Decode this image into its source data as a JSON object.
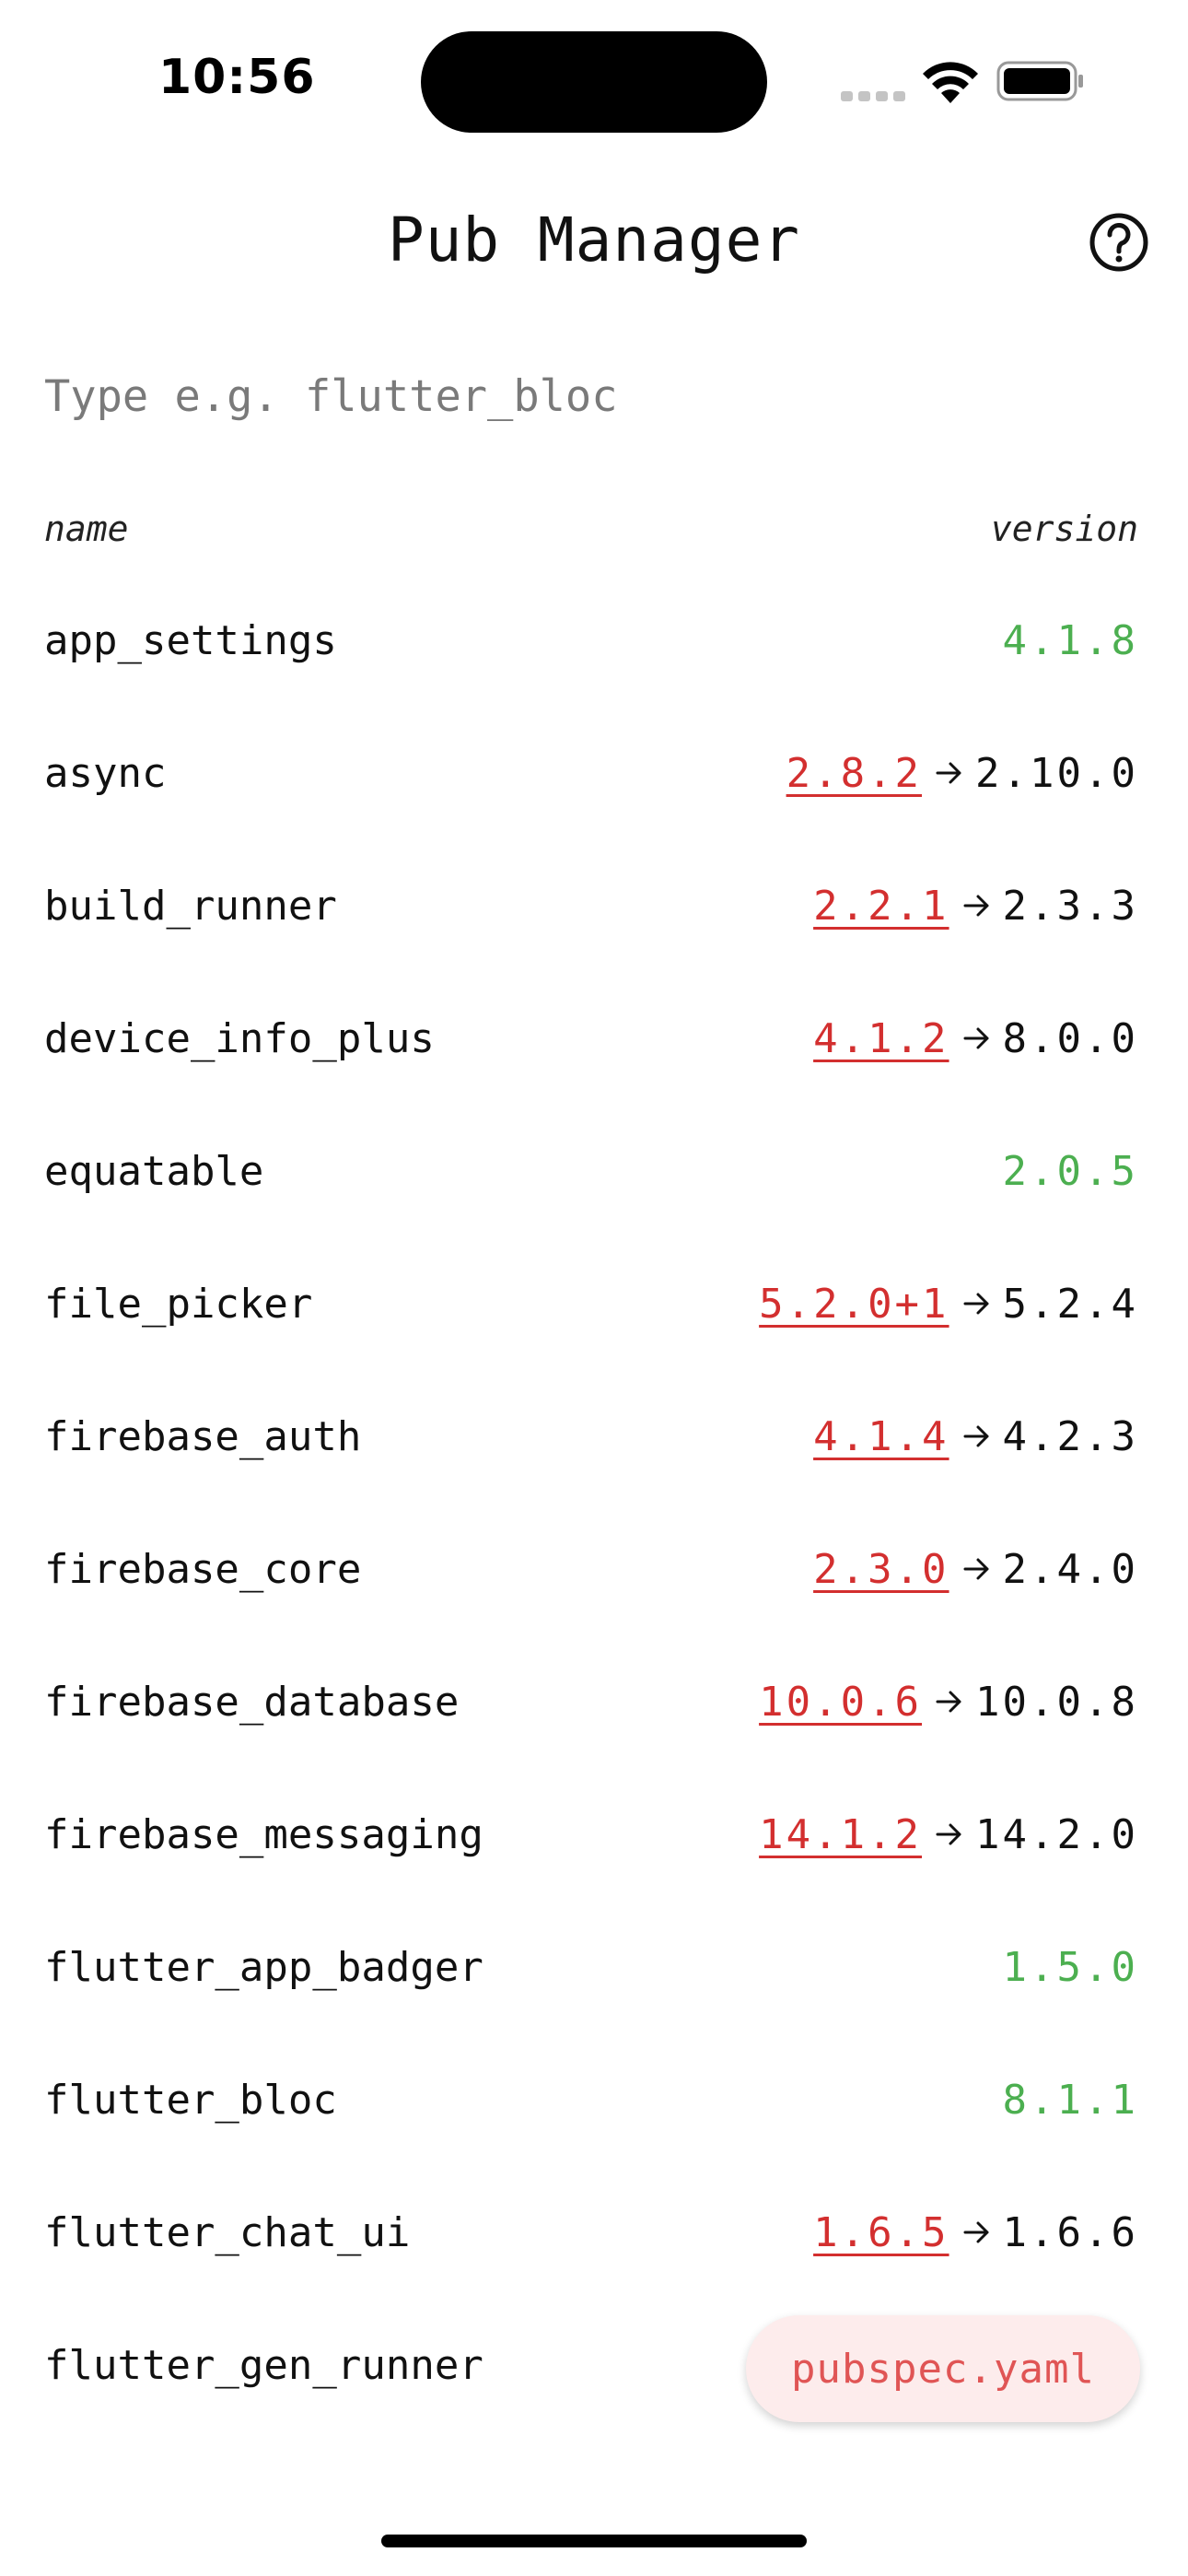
{
  "status_bar": {
    "time": "10:56"
  },
  "header": {
    "title": "Pub Manager",
    "help_icon": "question-circle-icon"
  },
  "search": {
    "placeholder": "Type e.g. flutter_bloc",
    "value": ""
  },
  "table": {
    "col_name": "name",
    "col_version": "version"
  },
  "packages": [
    {
      "name": "app_settings",
      "current": "4.1.8",
      "latest": "",
      "up_to_date": true
    },
    {
      "name": "async",
      "current": "2.8.2",
      "latest": "2.10.0",
      "up_to_date": false
    },
    {
      "name": "build_runner",
      "current": "2.2.1",
      "latest": "2.3.3",
      "up_to_date": false
    },
    {
      "name": "device_info_plus",
      "current": "4.1.2",
      "latest": "8.0.0",
      "up_to_date": false
    },
    {
      "name": "equatable",
      "current": "2.0.5",
      "latest": "",
      "up_to_date": true
    },
    {
      "name": "file_picker",
      "current": "5.2.0+1",
      "latest": "5.2.4",
      "up_to_date": false
    },
    {
      "name": "firebase_auth",
      "current": "4.1.4",
      "latest": "4.2.3",
      "up_to_date": false
    },
    {
      "name": "firebase_core",
      "current": "2.3.0",
      "latest": "2.4.0",
      "up_to_date": false
    },
    {
      "name": "firebase_database",
      "current": "10.0.6",
      "latest": "10.0.8",
      "up_to_date": false
    },
    {
      "name": "firebase_messaging",
      "current": "14.1.2",
      "latest": "14.2.0",
      "up_to_date": false
    },
    {
      "name": "flutter_app_badger",
      "current": "1.5.0",
      "latest": "",
      "up_to_date": true
    },
    {
      "name": "flutter_bloc",
      "current": "8.1.1",
      "latest": "",
      "up_to_date": true
    },
    {
      "name": "flutter_chat_ui",
      "current": "1.6.5",
      "latest": "1.6.6",
      "up_to_date": false
    },
    {
      "name": "flutter_gen_runner",
      "current": "",
      "latest": "",
      "up_to_date": true
    }
  ],
  "fab": {
    "label": "pubspec.yaml"
  },
  "colors": {
    "up_to_date": "#4caf50",
    "outdated": "#d32f2f",
    "fab_bg": "#fdecec",
    "fab_text": "#e05555"
  }
}
